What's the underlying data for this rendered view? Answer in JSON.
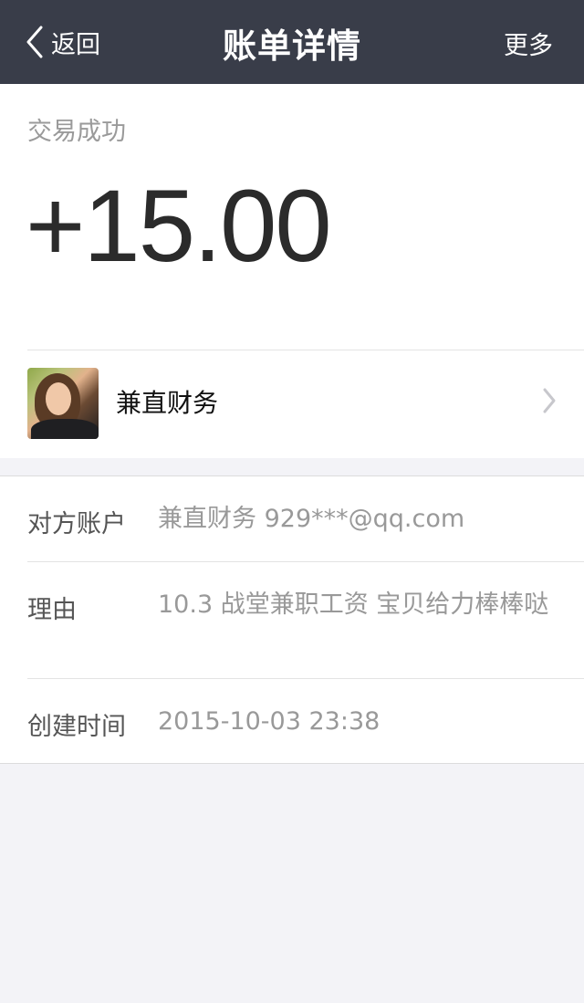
{
  "navbar": {
    "back_label": "返回",
    "title": "账单详情",
    "more_label": "更多"
  },
  "summary": {
    "status": "交易成功",
    "amount": "+15.00"
  },
  "payer": {
    "name": "兼直财务"
  },
  "details": [
    {
      "label": "对方账户",
      "value": "兼直财务 929***@qq.com"
    },
    {
      "label": "理由",
      "value": "10.3 战堂兼职工资 宝贝给力棒棒哒"
    },
    {
      "label": "创建时间",
      "value": "2015-10-03 23:38"
    }
  ],
  "colors": {
    "navbar_bg": "#393d49",
    "page_bg": "#f3f3f7"
  }
}
